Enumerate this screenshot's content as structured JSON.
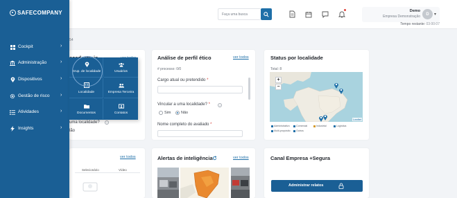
{
  "brand": {
    "logo_text": "SAFECOMPANY"
  },
  "header": {
    "search_placeholder": "Faça uma busca",
    "user_name": "Demo",
    "user_company": "Empresa Demonstração",
    "avatar_initials": "D",
    "time_label": "Tempo restante:",
    "time_value": "03:00:07"
  },
  "subheader": {
    "text": "54"
  },
  "sidebar": {
    "items": [
      {
        "label": "Cockpit",
        "icon": "grid-icon"
      },
      {
        "label": "Administração",
        "icon": "bank-icon"
      },
      {
        "label": "Dispositivos",
        "icon": "location-pin-icon"
      },
      {
        "label": "Gestão de risco",
        "icon": "gear-icon"
      },
      {
        "label": "Atividades",
        "icon": "list-icon"
      },
      {
        "label": "Insights",
        "icon": "bolt-icon"
      }
    ]
  },
  "flyout": {
    "items": [
      {
        "label": "Grup. de localidade",
        "icon": "map-pin-icon"
      },
      {
        "label": "Usuários",
        "icon": "users-icon"
      },
      {
        "label": "Localidade",
        "icon": "building-icon"
      },
      {
        "label": "Empresa Terceira",
        "icon": "user-group-icon"
      },
      {
        "label": "Documentos",
        "icon": "folder-icon"
      },
      {
        "label": "Contatos",
        "icon": "contact-card-icon"
      }
    ]
  },
  "card_left_top": {
    "title_fragment": "scadastrais",
    "link": "ver todos",
    "question_fragment": "uma localidade?",
    "answer_fragment": "lão"
  },
  "card_perfil": {
    "title": "Análise de perfil ético",
    "link": "ver todos",
    "processo_label": "# processo:",
    "processo_value": "0/0",
    "cargo_label": "Cargo atual ou pretendido",
    "vincular_label": "Vincular a uma localidade?",
    "opt_sim": "Sim",
    "opt_nao": "Não",
    "nome_label": "Nome completo do avaliado",
    "required_mark": "*"
  },
  "card_status": {
    "title": "Status por localidade",
    "total_label": "Total: 8",
    "zoom_in": "+",
    "zoom_out": "−",
    "attribution": "Leaflet",
    "legend": [
      {
        "label": "Administrativo",
        "color": "#1e6fa8"
      },
      {
        "label": "Comercial",
        "color": "#1e6fa8"
      },
      {
        "label": "Industrial",
        "color": "#d69a2c"
      },
      {
        "label": "Logística",
        "color": "#1e6fa8"
      },
      {
        "label": "Multi-propósito",
        "color": "#1e6fa8"
      },
      {
        "label": "Outros",
        "color": "#1e6fa8"
      }
    ]
  },
  "card_left_bottom": {
    "link": "ver todos",
    "col_a": "Selecionário",
    "col_b": "Vídeo"
  },
  "card_alertas": {
    "title": "Alertas de inteligência",
    "link": "ver todos"
  },
  "card_canal": {
    "title": "Canal Empresa +Segura",
    "button_label": "Administrar relatos"
  }
}
